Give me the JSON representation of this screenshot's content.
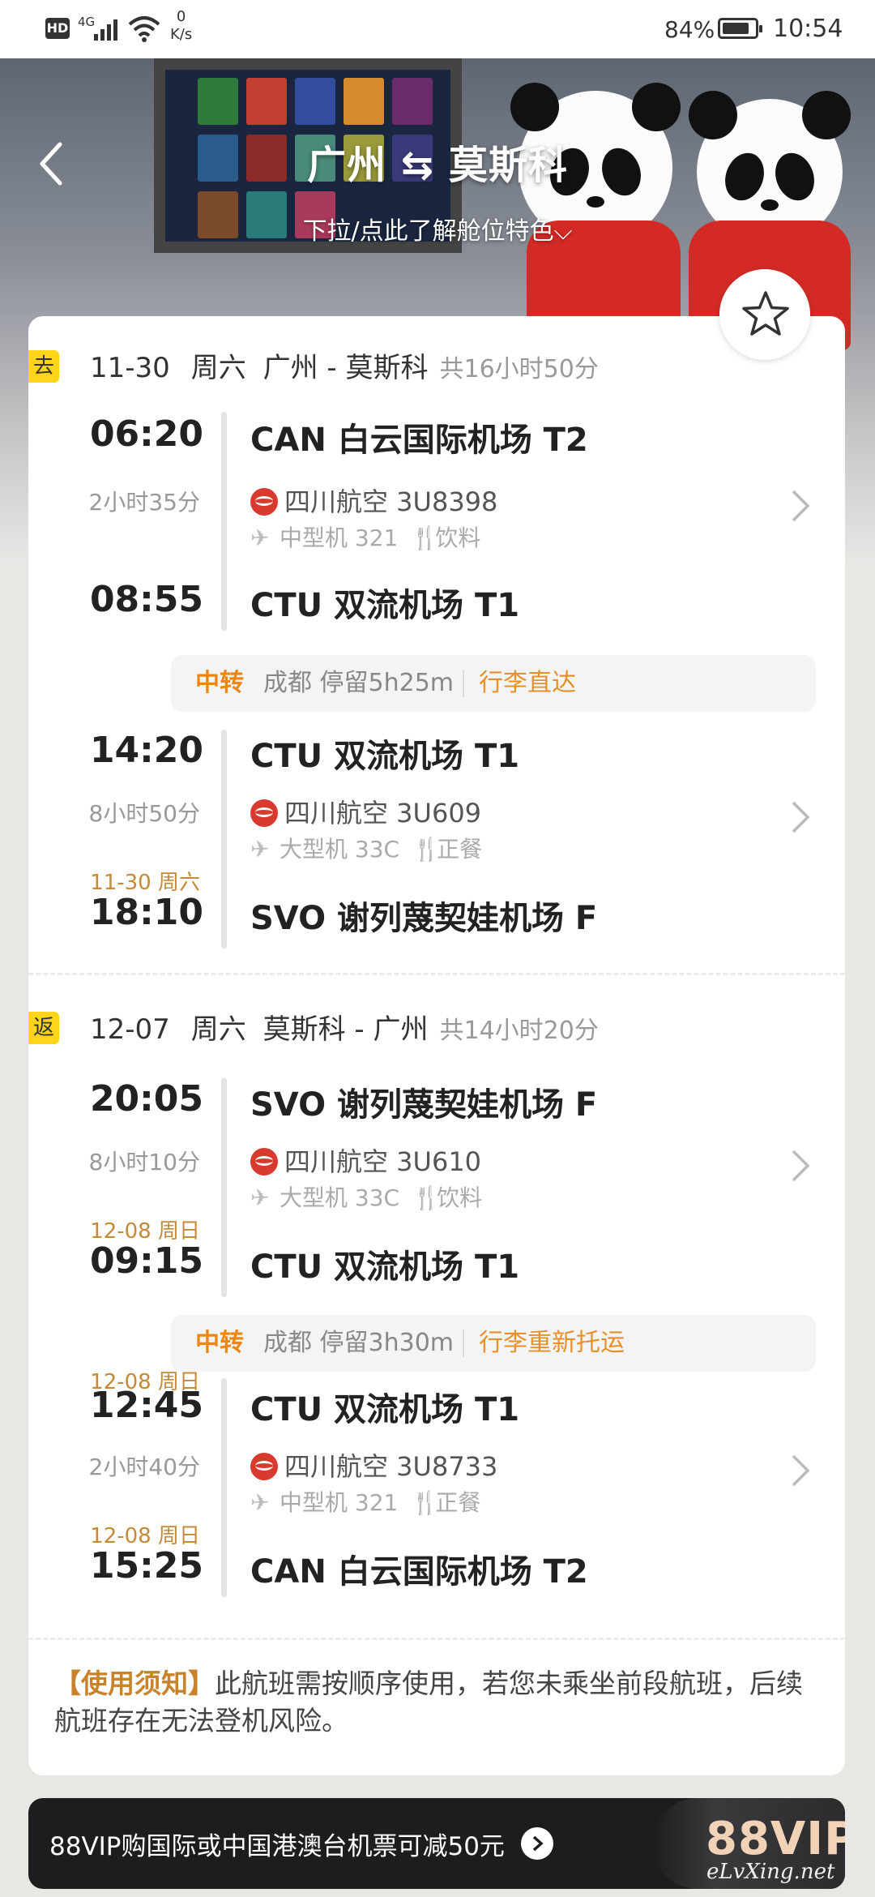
{
  "status_bar": {
    "hd": "HD",
    "network": "4G",
    "speed_value": "0",
    "speed_unit": "K/s",
    "battery_pct": "84%",
    "battery_level": 0.84,
    "time": "10:54"
  },
  "header": {
    "title": "广州 ⇆ 莫斯科",
    "subtitle": "下拉/点此了解舱位特色⌵"
  },
  "outbound": {
    "tag": "去",
    "date": "11-30",
    "weekday": "周六",
    "route": "广州 - 莫斯科",
    "total": "共16小时50分",
    "legs": [
      {
        "dep_time": "06:20",
        "dep_airport": "CAN 白云国际机场 T2",
        "duration": "2小时35分",
        "airline": "四川航空 3U8398",
        "aircraft": "中型机 321",
        "meal": "饮料",
        "arr_date": "",
        "arr_time": "08:55",
        "arr_airport": "CTU 双流机场 T1"
      },
      {
        "dep_time": "14:20",
        "dep_airport": "CTU 双流机场 T1",
        "duration": "8小时50分",
        "airline": "四川航空 3U609",
        "aircraft": "大型机 33C",
        "meal": "正餐",
        "arr_date": "11-30 周六",
        "arr_time": "18:10",
        "arr_airport": "SVO 谢列蔑契娃机场 F"
      }
    ],
    "transfer": {
      "label": "中转",
      "stay": "成都 停留5h25m",
      "baggage": "行李直达"
    }
  },
  "return": {
    "tag": "返",
    "date": "12-07",
    "weekday": "周六",
    "route": "莫斯科 - 广州",
    "total": "共14小时20分",
    "legs": [
      {
        "dep_date": "",
        "dep_time": "20:05",
        "dep_airport": "SVO 谢列蔑契娃机场 F",
        "duration": "8小时10分",
        "airline": "四川航空 3U610",
        "aircraft": "大型机 33C",
        "meal": "饮料",
        "arr_date": "12-08 周日",
        "arr_time": "09:15",
        "arr_airport": "CTU 双流机场 T1"
      },
      {
        "dep_date": "12-08 周日",
        "dep_time": "12:45",
        "dep_airport": "CTU 双流机场 T1",
        "duration": "2小时40分",
        "airline": "四川航空 3U8733",
        "aircraft": "中型机 321",
        "meal": "正餐",
        "arr_date": "12-08 周日",
        "arr_time": "15:25",
        "arr_airport": "CAN 白云国际机场 T2"
      }
    ],
    "transfer": {
      "label": "中转",
      "stay": "成都 停留3h30m",
      "baggage": "行李重新托运"
    }
  },
  "notice": {
    "label": "【使用须知】",
    "text": "此航班需按顺序使用，若您未乘坐前段航班，后续航班存在无法登机风险。"
  },
  "vip_banner": {
    "text": "88VIP购国际或中国港澳台机票可减50元",
    "logo": "88VIP"
  },
  "watermark": "eLvXing.net",
  "colors": {
    "tag_yellow": "#ffd51c",
    "transfer_orange": "#f0860e",
    "date_gold": "#c58a37",
    "airline_red": "#d83a2f"
  },
  "icons": [
    "back-arrow-icon",
    "star-icon",
    "sichuan-airlines-logo-icon",
    "plane-icon",
    "meal-icon",
    "chevron-right-icon",
    "arrow-right-circle-icon"
  ]
}
